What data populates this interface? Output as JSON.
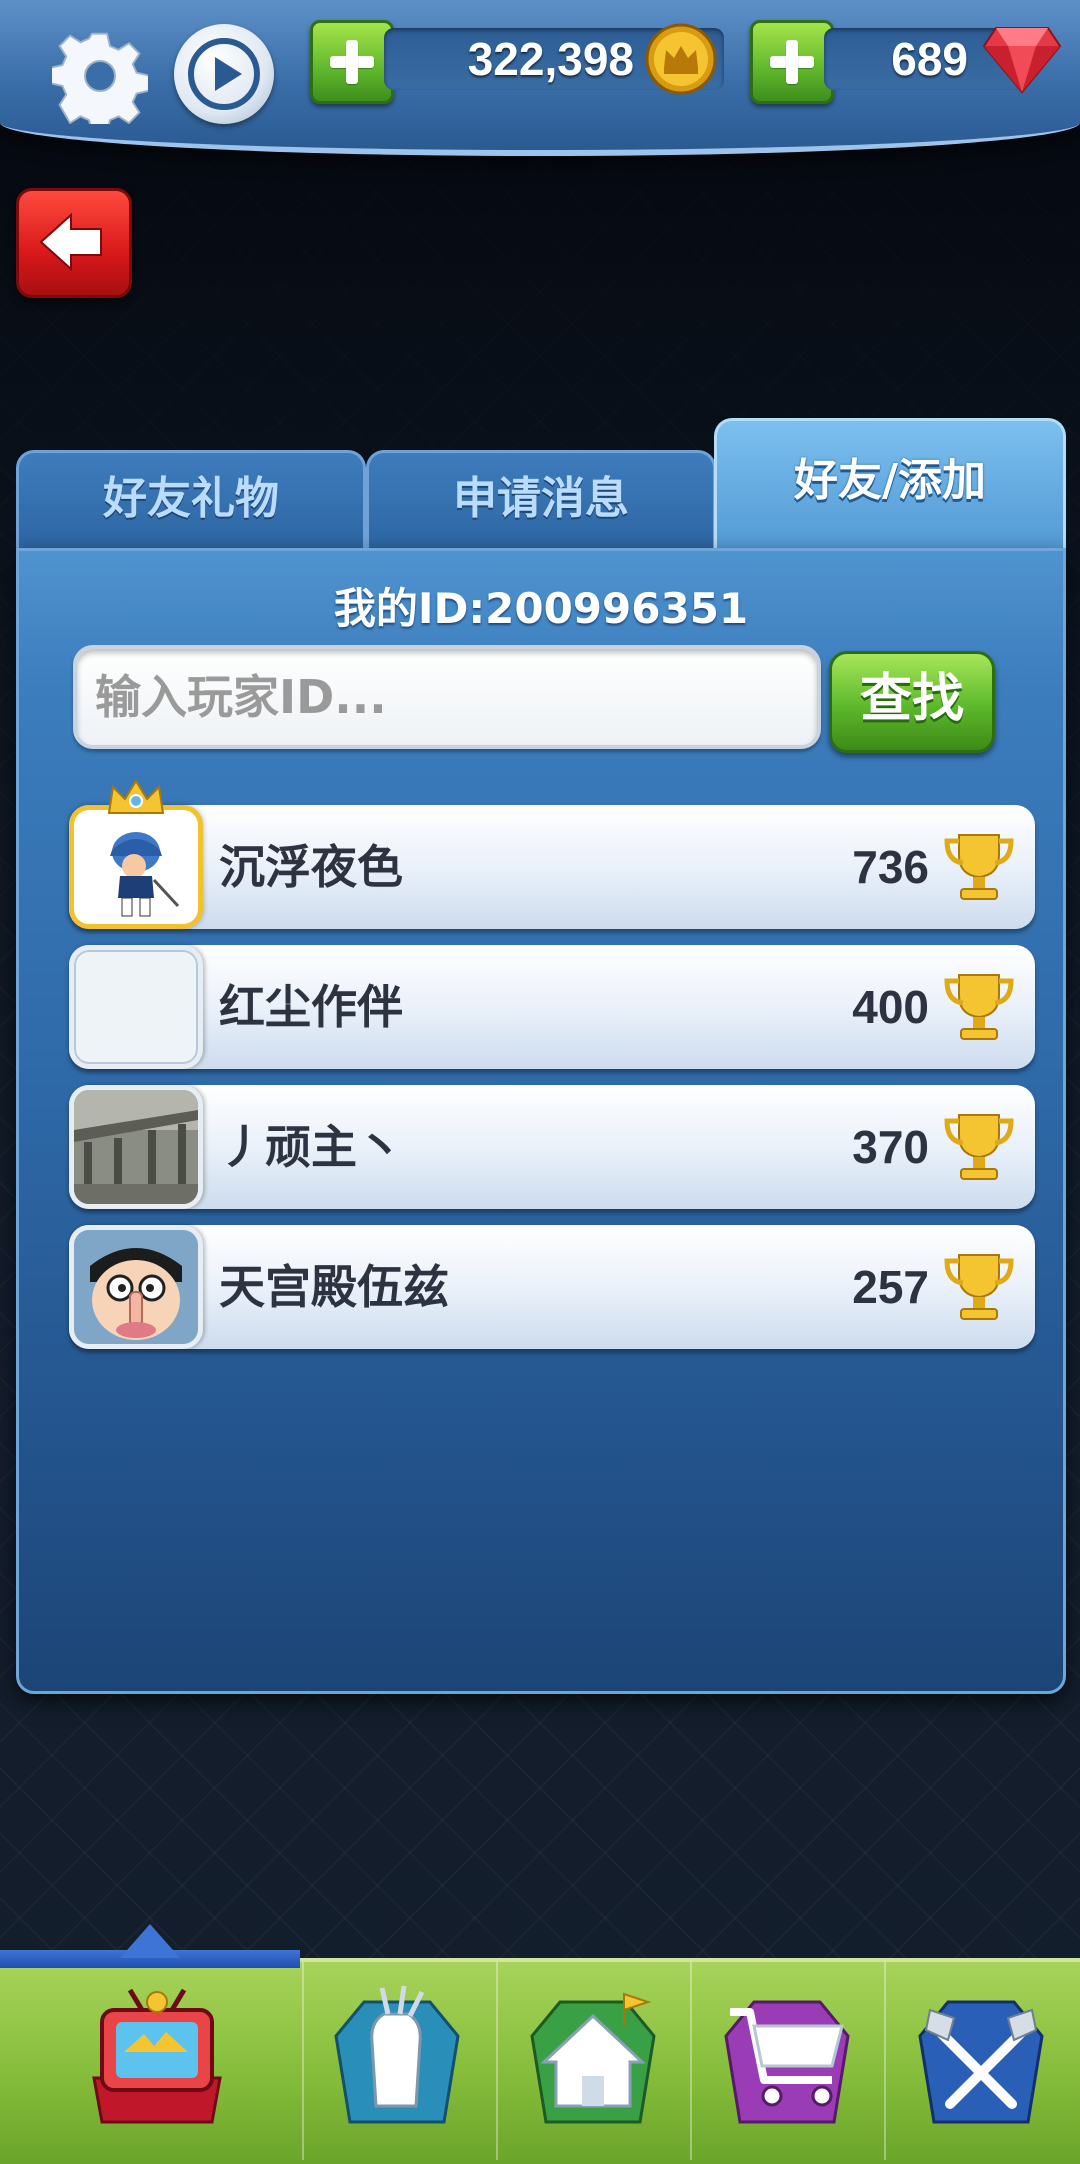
{
  "currency": {
    "coins": "322,398",
    "gems": "689"
  },
  "tabs": [
    {
      "label": "好友礼物",
      "active": false
    },
    {
      "label": "申请消息",
      "active": false
    },
    {
      "label": "好友/添加",
      "active": true
    }
  ],
  "panel": {
    "my_id_label": "我的ID:",
    "my_id_value": "200996351",
    "search_placeholder": "输入玩家ID...",
    "find_label": "查找"
  },
  "friends": [
    {
      "name": "沉浮夜色",
      "score": "736"
    },
    {
      "name": "红尘作伴",
      "score": "400"
    },
    {
      "name": "丿顽主丶",
      "score": "370"
    },
    {
      "name": "天宫殿伍兹",
      "score": "257"
    }
  ],
  "nav": [
    {
      "icon": "tv-icon",
      "active": true
    },
    {
      "icon": "golf-bag-icon",
      "active": false
    },
    {
      "icon": "home-icon",
      "active": false
    },
    {
      "icon": "shop-cart-icon",
      "active": false
    },
    {
      "icon": "crossed-clubs-icon",
      "active": false
    }
  ],
  "colors": {
    "panel_blue": "#2f6aa9",
    "tab_active": "#5fa6dc",
    "button_green": "#5cb82b",
    "back_red": "#d8181a",
    "nav_green": "#86bd3b"
  }
}
